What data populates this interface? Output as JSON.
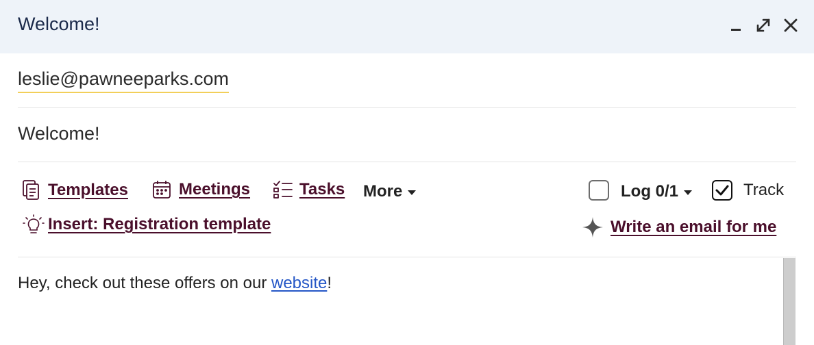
{
  "window": {
    "title": "Welcome!",
    "controls": [
      "minimize-icon",
      "expand-icon",
      "close-icon"
    ]
  },
  "to": {
    "value": "leslie@pawneeparks.com"
  },
  "subject": {
    "value": "Welcome!"
  },
  "toolbar": {
    "templates_label": "Templates",
    "meetings_label": "Meetings",
    "tasks_label": "Tasks",
    "more_label": "More",
    "log_label": "Log 0/1",
    "log_checked": false,
    "track_label": "Track",
    "track_checked": true,
    "insert_label": "Insert: Registration template",
    "write_label": "Write an email for me"
  },
  "body": {
    "text_before": "Hey, check out these offers on our ",
    "link_text": "website",
    "text_after": "!"
  },
  "colors": {
    "titlebar_bg": "#eef3f9",
    "link_accent": "#4a0f2b",
    "hyperlink": "#2456c6",
    "field_underline": "#f2cf5a"
  }
}
